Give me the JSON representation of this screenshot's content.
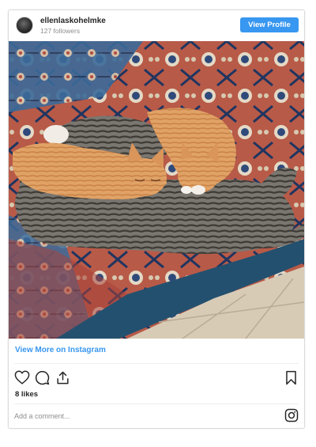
{
  "header": {
    "username": "ellenlaskohelmke",
    "followers": "127 followers",
    "view_profile_label": "View Profile"
  },
  "post": {
    "image_icon": "photo-cats-on-rug",
    "view_more_label": "View More on Instagram",
    "likes": "8 likes",
    "comment_placeholder": "Add a comment..."
  },
  "actions": {
    "icons": [
      "heart-icon",
      "comment-icon",
      "share-icon",
      "bookmark-icon",
      "instagram-icon"
    ]
  },
  "colors": {
    "accent": "#3897f0",
    "text": "#262626",
    "muted": "#8e8e8e",
    "border": "#dbdbdb"
  }
}
